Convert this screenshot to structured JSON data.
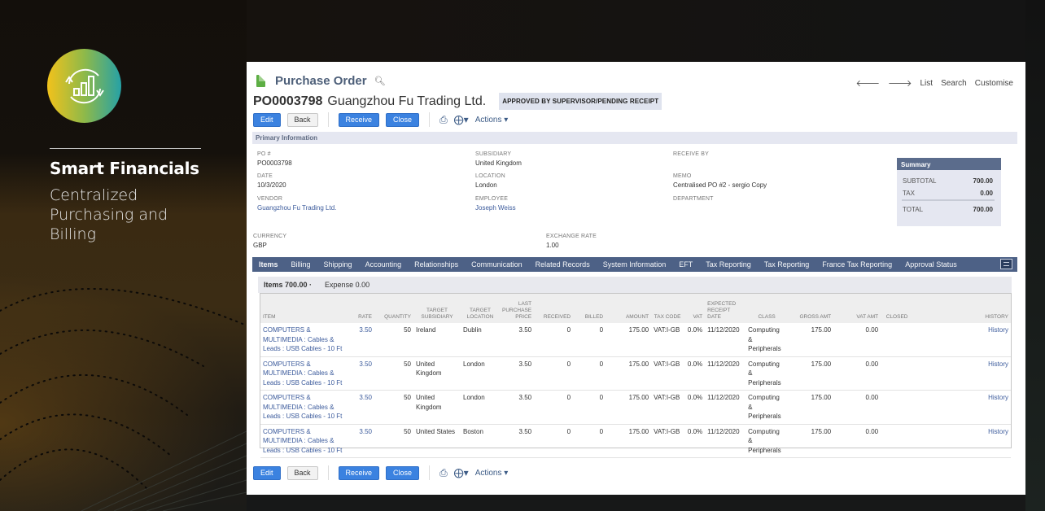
{
  "slide": {
    "brand_title": "Smart Financials",
    "brand_subtitle": "Centralized Purchasing and Billing",
    "logo_icon": "analytics-cycle-icon"
  },
  "header": {
    "page_type": "Purchase Order",
    "record_number": "PO0003798",
    "vendor_name": "Guangzhou Fu Trading Ltd.",
    "status": "APPROVED BY SUPERVISOR/PENDING RECEIPT",
    "nav_links": [
      "List",
      "Search",
      "Customise"
    ]
  },
  "toolbar": {
    "edit_label": "Edit",
    "back_label": "Back",
    "receive_label": "Receive",
    "close_label": "Close",
    "actions_label": "Actions"
  },
  "primary": {
    "section_title": "Primary Information",
    "po_number_label": "PO #",
    "po_number": "PO0003798",
    "date_label": "DATE",
    "date": "10/3/2020",
    "vendor_label": "VENDOR",
    "vendor": "Guangzhou Fu Trading Ltd.",
    "subsidiary_label": "SUBSIDIARY",
    "subsidiary": "United Kingdom",
    "location_label": "LOCATION",
    "location": "London",
    "employee_label": "EMPLOYEE",
    "employee": "Joseph Weiss",
    "receive_by_label": "RECEIVE BY",
    "memo_label": "MEMO",
    "memo": "Centralised PO #2 - sergio Copy",
    "department_label": "DEPARTMENT",
    "currency_label": "CURRENCY",
    "currency": "GBP",
    "exchange_rate_label": "EXCHANGE RATE",
    "exchange_rate": "1.00"
  },
  "summary": {
    "title": "Summary",
    "subtotal_label": "SUBTOTAL",
    "subtotal": "700.00",
    "tax_label": "TAX",
    "tax": "0.00",
    "total_label": "TOTAL",
    "total": "700.00"
  },
  "tabs": [
    "Items",
    "Billing",
    "Shipping",
    "Accounting",
    "Relationships",
    "Communication",
    "Related Records",
    "System Information",
    "EFT",
    "Tax Reporting",
    "Tax Reporting",
    "France Tax Reporting",
    "Approval Status"
  ],
  "subtabs": {
    "items": "Items 700.00",
    "expense": "Expense 0.00"
  },
  "items_table": {
    "columns": [
      "ITEM",
      "RATE",
      "QUANTITY",
      "TARGET SUBSIDIARY",
      "TARGET LOCATION",
      "LAST PURCHASE PRICE",
      "RECEIVED",
      "BILLED",
      "AMOUNT",
      "TAX CODE",
      "VAT",
      "EXPECTED RECEIPT DATE",
      "CLASS",
      "GROSS AMT",
      "VAT AMT",
      "CLOSED",
      "HISTORY"
    ],
    "rows": [
      {
        "item": "COMPUTERS & MULTIMEDIA : Cables & Leads : USB Cables - 10 Ft",
        "rate": "3.50",
        "quantity": "50",
        "target_subsidiary": "Ireland",
        "target_location": "Dublin",
        "last_purchase_price": "3.50",
        "received": "0",
        "billed": "0",
        "amount": "175.00",
        "tax_code": "VAT:I-GB",
        "vat": "0.0%",
        "expected_receipt_date": "11/12/2020",
        "class": "Computing & Peripherals",
        "gross_amt": "175.00",
        "vat_amt": "0.00",
        "closed": "",
        "history": "History"
      },
      {
        "item": "COMPUTERS & MULTIMEDIA : Cables & Leads : USB Cables - 10 Ft",
        "rate": "3.50",
        "quantity": "50",
        "target_subsidiary": "United Kingdom",
        "target_location": "London",
        "last_purchase_price": "3.50",
        "received": "0",
        "billed": "0",
        "amount": "175.00",
        "tax_code": "VAT:I-GB",
        "vat": "0.0%",
        "expected_receipt_date": "11/12/2020",
        "class": "Computing & Peripherals",
        "gross_amt": "175.00",
        "vat_amt": "0.00",
        "closed": "",
        "history": "History"
      },
      {
        "item": "COMPUTERS & MULTIMEDIA : Cables & Leads : USB Cables - 10 Ft",
        "rate": "3.50",
        "quantity": "50",
        "target_subsidiary": "United Kingdom",
        "target_location": "London",
        "last_purchase_price": "3.50",
        "received": "0",
        "billed": "0",
        "amount": "175.00",
        "tax_code": "VAT:I-GB",
        "vat": "0.0%",
        "expected_receipt_date": "11/12/2020",
        "class": "Computing & Peripherals",
        "gross_amt": "175.00",
        "vat_amt": "0.00",
        "closed": "",
        "history": "History"
      },
      {
        "item": "COMPUTERS & MULTIMEDIA : Cables & Leads : USB Cables - 10 Ft",
        "rate": "3.50",
        "quantity": "50",
        "target_subsidiary": "United States",
        "target_location": "Boston",
        "last_purchase_price": "3.50",
        "received": "0",
        "billed": "0",
        "amount": "175.00",
        "tax_code": "VAT:I-GB",
        "vat": "0.0%",
        "expected_receipt_date": "11/12/2020",
        "class": "Computing & Peripherals",
        "gross_amt": "175.00",
        "vat_amt": "0.00",
        "closed": "",
        "history": "History"
      }
    ]
  },
  "colors": {
    "primary_button": "#3b82e0",
    "tab_bar": "#4d6186",
    "link": "#3c5b9c",
    "status_badge_bg": "#dfe3ee",
    "summary_header": "#5b6c8c"
  }
}
